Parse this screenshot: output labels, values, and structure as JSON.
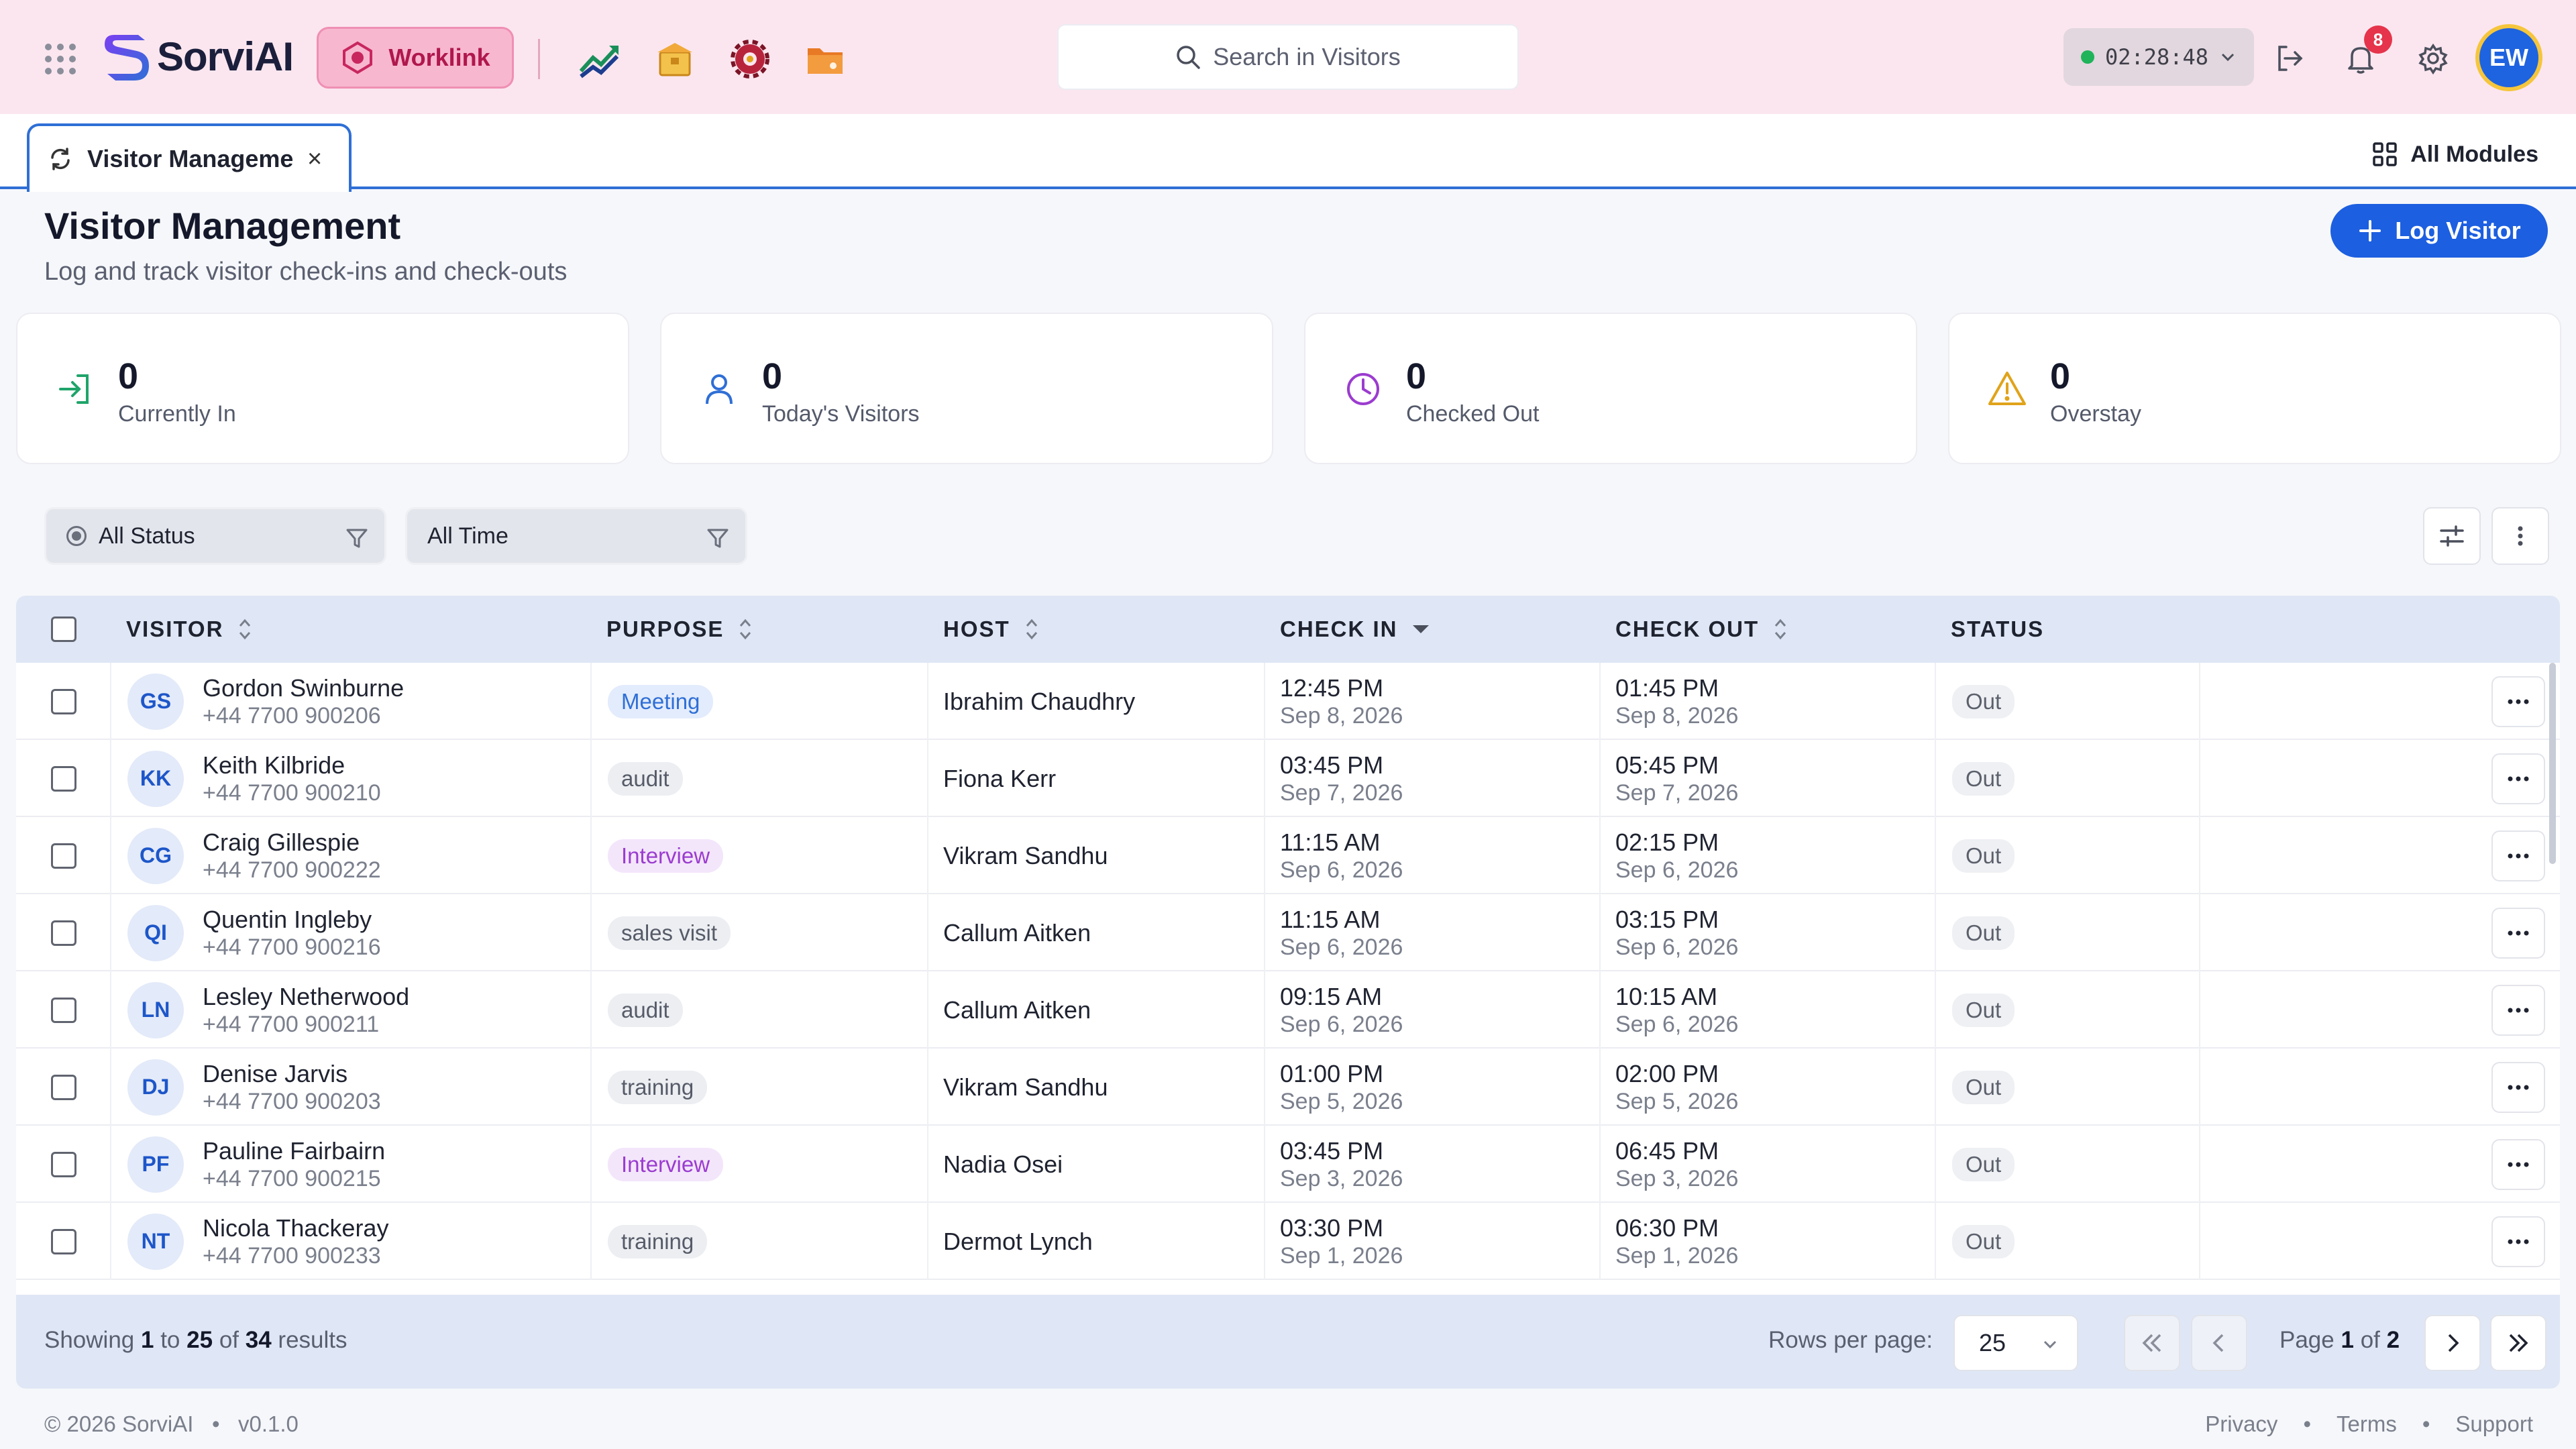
{
  "app": {
    "name": "SorviAI",
    "workspace_label": "Worklink",
    "search_placeholder": "Search in Visitors",
    "timer": "02:28:48",
    "notification_count": "8",
    "user_initials": "EW",
    "accent_color": "#1c5fe0"
  },
  "tabs": {
    "active_label": "Visitor Management",
    "close_symbol": "×",
    "all_modules_label": "All Modules"
  },
  "page": {
    "title": "Visitor Management",
    "subtitle": "Log and track visitor check-ins and check-outs",
    "log_button_label": "Log Visitor"
  },
  "stats": [
    {
      "value": "0",
      "label": "Currently In",
      "icon": "sign-in-icon",
      "color": "#1fa46a"
    },
    {
      "value": "0",
      "label": "Today's Visitors",
      "icon": "user-icon",
      "color": "#2f6fd6"
    },
    {
      "value": "0",
      "label": "Checked Out",
      "icon": "clock-icon",
      "color": "#9b3ccf"
    },
    {
      "value": "0",
      "label": "Overstay",
      "icon": "warning-icon",
      "color": "#e0a31a"
    }
  ],
  "filters": {
    "status_label": "All Status",
    "time_label": "All Time"
  },
  "table": {
    "columns": [
      "VISITOR",
      "PURPOSE",
      "HOST",
      "CHECK IN",
      "CHECK OUT",
      "STATUS"
    ],
    "rows": [
      {
        "initials": "GS",
        "name": "Gordon Swinburne",
        "phone": "+44 7700 900206",
        "purpose": "Meeting",
        "purpose_style": "meeting",
        "host": "Ibrahim Chaudhry",
        "in_time": "12:45 PM",
        "in_date": "Sep 8, 2026",
        "out_time": "01:45 PM",
        "out_date": "Sep 8, 2026",
        "status": "Out"
      },
      {
        "initials": "KK",
        "name": "Keith Kilbride",
        "phone": "+44 7700 900210",
        "purpose": "audit",
        "purpose_style": "plain",
        "host": "Fiona Kerr",
        "in_time": "03:45 PM",
        "in_date": "Sep 7, 2026",
        "out_time": "05:45 PM",
        "out_date": "Sep 7, 2026",
        "status": "Out"
      },
      {
        "initials": "CG",
        "name": "Craig Gillespie",
        "phone": "+44 7700 900222",
        "purpose": "Interview",
        "purpose_style": "interview",
        "host": "Vikram Sandhu",
        "in_time": "11:15 AM",
        "in_date": "Sep 6, 2026",
        "out_time": "02:15 PM",
        "out_date": "Sep 6, 2026",
        "status": "Out"
      },
      {
        "initials": "QI",
        "name": "Quentin Ingleby",
        "phone": "+44 7700 900216",
        "purpose": "sales visit",
        "purpose_style": "plain",
        "host": "Callum Aitken",
        "in_time": "11:15 AM",
        "in_date": "Sep 6, 2026",
        "out_time": "03:15 PM",
        "out_date": "Sep 6, 2026",
        "status": "Out"
      },
      {
        "initials": "LN",
        "name": "Lesley Netherwood",
        "phone": "+44 7700 900211",
        "purpose": "audit",
        "purpose_style": "plain",
        "host": "Callum Aitken",
        "in_time": "09:15 AM",
        "in_date": "Sep 6, 2026",
        "out_time": "10:15 AM",
        "out_date": "Sep 6, 2026",
        "status": "Out"
      },
      {
        "initials": "DJ",
        "name": "Denise Jarvis",
        "phone": "+44 7700 900203",
        "purpose": "training",
        "purpose_style": "plain",
        "host": "Vikram Sandhu",
        "in_time": "01:00 PM",
        "in_date": "Sep 5, 2026",
        "out_time": "02:00 PM",
        "out_date": "Sep 5, 2026",
        "status": "Out"
      },
      {
        "initials": "PF",
        "name": "Pauline Fairbairn",
        "phone": "+44 7700 900215",
        "purpose": "Interview",
        "purpose_style": "interview",
        "host": "Nadia Osei",
        "in_time": "03:45 PM",
        "in_date": "Sep 3, 2026",
        "out_time": "06:45 PM",
        "out_date": "Sep 3, 2026",
        "status": "Out"
      },
      {
        "initials": "NT",
        "name": "Nicola Thackeray",
        "phone": "+44 7700 900233",
        "purpose": "training",
        "purpose_style": "plain",
        "host": "Dermot Lynch",
        "in_time": "03:30 PM",
        "in_date": "Sep 1, 2026",
        "out_time": "06:30 PM",
        "out_date": "Sep 1, 2026",
        "status": "Out"
      }
    ]
  },
  "pagination": {
    "showing_prefix": "Showing",
    "from": "1",
    "to_word": "to",
    "to": "25",
    "of_word": "of",
    "total": "34",
    "results_word": "results",
    "rows_per_page_label": "Rows per page:",
    "rows_per_page": "25",
    "page_word": "Page",
    "page": "1",
    "page_of": "of",
    "pages": "2"
  },
  "footer": {
    "copyright": "© 2026 SorviAI",
    "version": "v0.1.0",
    "links": [
      "Privacy",
      "Terms",
      "Support"
    ]
  }
}
